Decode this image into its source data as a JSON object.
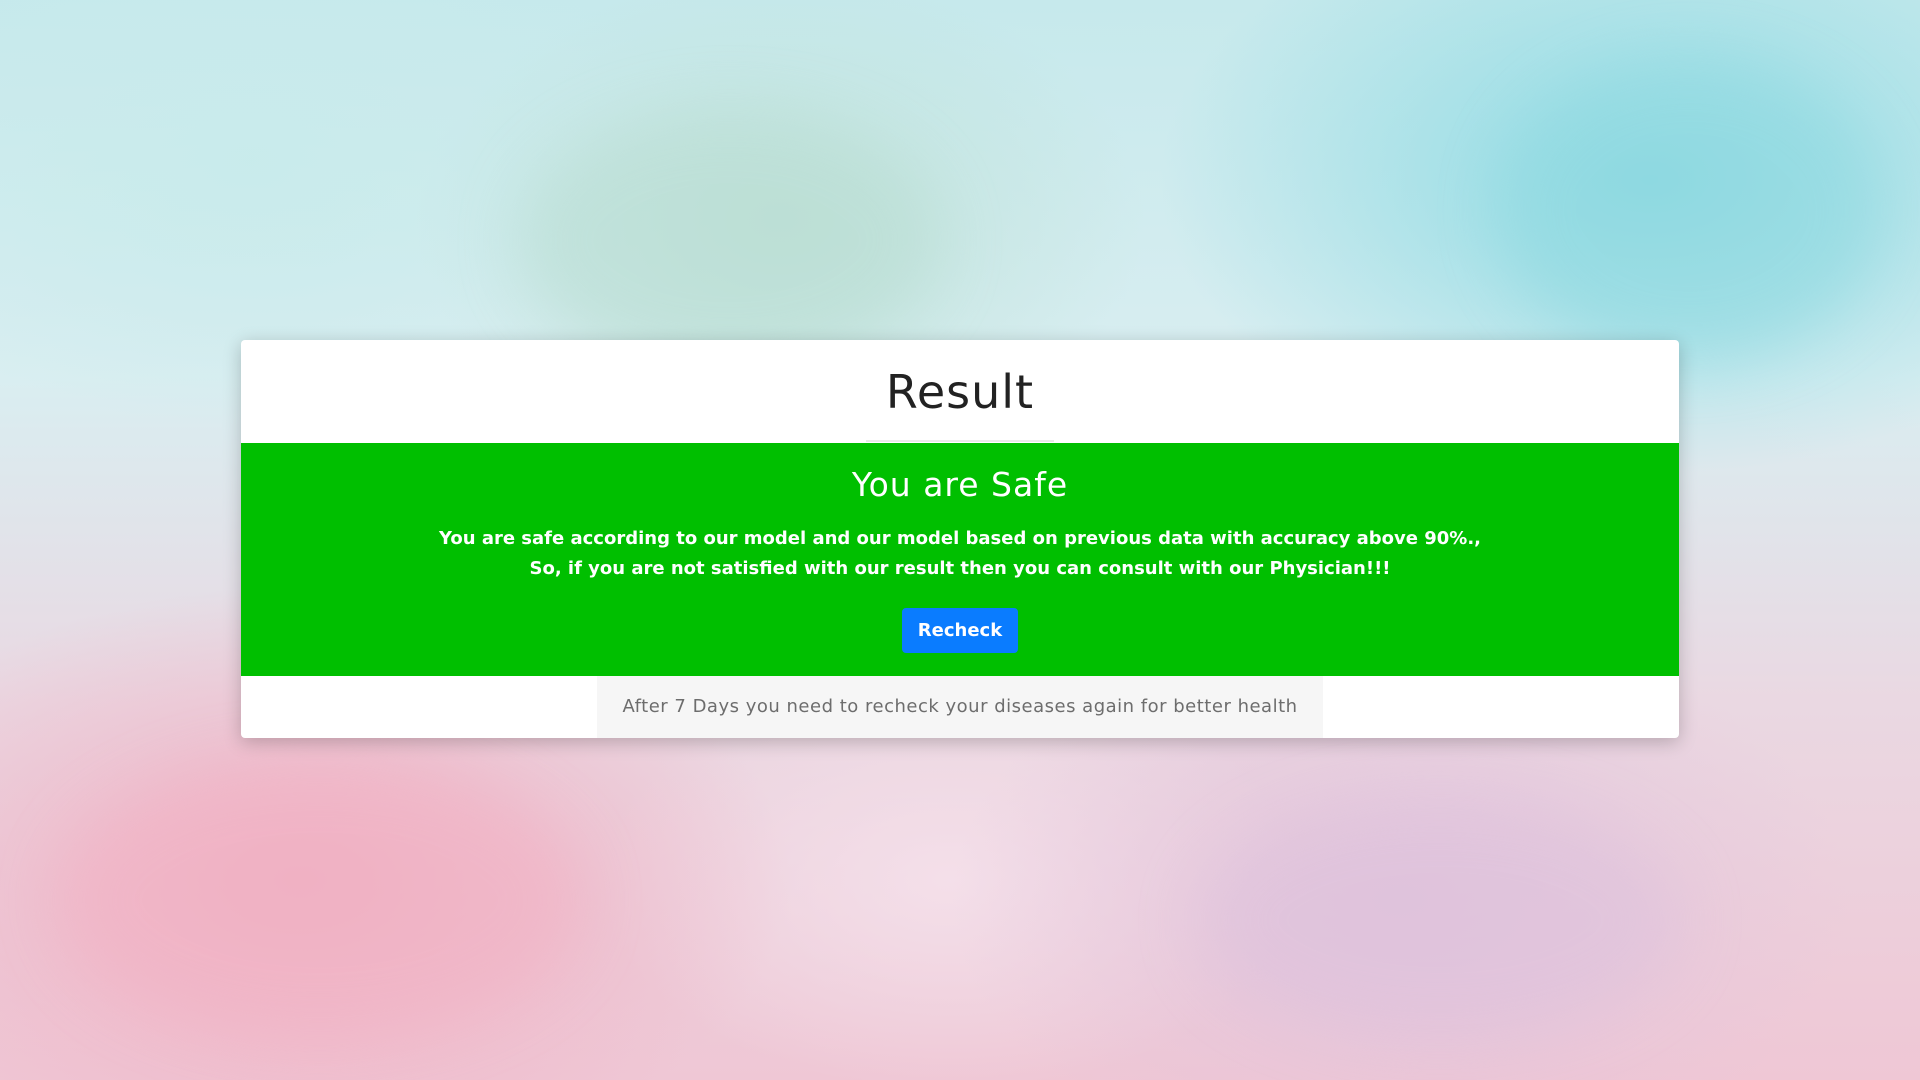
{
  "card": {
    "title": "Result"
  },
  "result": {
    "heading": "You are Safe",
    "message_line1": "You are safe according to our model and our model based on previous data with accuracy above 90%.,",
    "message_line2": "So, if you are not satisfied with our result then you can consult with our Physician!!!",
    "status_color": "#00bf00",
    "button_label": "Recheck",
    "button_color": "#0a7cff"
  },
  "footer": {
    "note": "After 7 Days you need to recheck your diseases again for better health"
  }
}
